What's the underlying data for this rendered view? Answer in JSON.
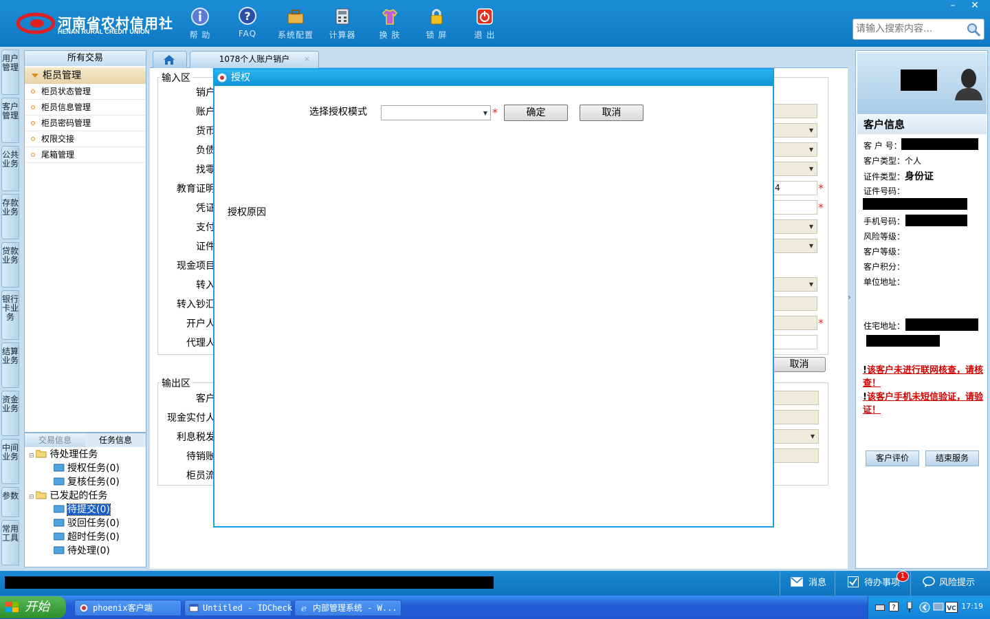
{
  "app": {
    "logo_cn": "河南省农村信用社",
    "logo_en": "HENAN RURAL CREDIT UNION"
  },
  "toolbar": [
    {
      "label": "帮 助",
      "icon": "info-icon"
    },
    {
      "label": "FAQ",
      "icon": "question-icon"
    },
    {
      "label": "系统配置",
      "icon": "toolbox-icon"
    },
    {
      "label": "计算器",
      "icon": "calculator-icon"
    },
    {
      "label": "换 肤",
      "icon": "shirt-icon"
    },
    {
      "label": "锁 屏",
      "icon": "lock-icon"
    },
    {
      "label": "退 出",
      "icon": "power-icon"
    }
  ],
  "window_controls": {
    "minimize": "–",
    "close": "✕"
  },
  "search": {
    "placeholder": "请输入搜索内容..."
  },
  "vtabs": [
    "用户管理",
    "客户管理",
    "公共业务",
    "存款业务",
    "贷款业务",
    "银行卡业务",
    "结算业务",
    "资金业务",
    "中间业务",
    "参数",
    "常用工具"
  ],
  "menu": {
    "header": "所有交易",
    "group": "柜员管理",
    "items": [
      "柜员状态管理",
      "柜员信息管理",
      "柜员密码管理",
      "权限交接",
      "尾箱管理"
    ]
  },
  "task_panel": {
    "tabs": [
      "交易信息",
      "任务信息"
    ],
    "tree": [
      {
        "label": "待处理任务",
        "level": 0
      },
      {
        "label": "授权任务(0)",
        "level": 1
      },
      {
        "label": "复核任务(0)",
        "level": 1
      },
      {
        "label": "已发起的任务",
        "level": 0
      },
      {
        "label": "待提交(0)",
        "level": 1
      },
      {
        "label": "驳回任务(0)",
        "level": 1
      },
      {
        "label": "超时任务(0)",
        "level": 1
      },
      {
        "label": "待处理(0)",
        "level": 1
      }
    ]
  },
  "tabs": {
    "active": "1078个人账户销户",
    "close": "×"
  },
  "input_area": {
    "legend": "输入区",
    "labels": [
      "销户",
      "账户",
      "货币",
      "负债",
      "找零",
      "教育证明",
      "凭证",
      "支付",
      "证件",
      "现金项目",
      "转入",
      "转入钞汇",
      "开户人",
      "代理人"
    ],
    "partial_value": "4"
  },
  "output_area": {
    "legend": "输出区",
    "labels": [
      "客户",
      "现金实付人",
      "利息税发",
      "待销账",
      "柜员流"
    ]
  },
  "bg_cancel": "取消",
  "dialog": {
    "title": "授权",
    "mode_label": "选择授权模式",
    "mode_value": "",
    "ok": "确定",
    "cancel": "取消",
    "reason_label": "授权原因",
    "required": "*"
  },
  "customer": {
    "section_title": "客户信息",
    "fields": [
      {
        "label": "客 户 号：",
        "value": ""
      },
      {
        "label": "客户类型：",
        "value": "个人"
      },
      {
        "label": "证件类型：",
        "value": "身份证"
      },
      {
        "label": "证件号码：",
        "value": ""
      },
      {
        "label": "手机号码：",
        "value": ""
      },
      {
        "label": "风险等级：",
        "value": ""
      },
      {
        "label": "客户等级：",
        "value": ""
      },
      {
        "label": "客户积分：",
        "value": ""
      },
      {
        "label": "单位地址：",
        "value": ""
      },
      {
        "label": "住宅地址：",
        "value": ""
      }
    ],
    "warnings": [
      "该客户未进行联网核查，请核查！",
      "该客户手机未短信验证，请验证！"
    ],
    "buttons": [
      "客户评价",
      "结束服务"
    ]
  },
  "statusbar": {
    "messages": "消息",
    "todo": "待办事项",
    "todo_badge": "1",
    "risk": "风险提示"
  },
  "taskbar": {
    "start": "开始",
    "windows": [
      "phoenix客户端",
      "Untitled - IDCheck",
      "内部管理系统 - W..."
    ],
    "time": "17:19"
  },
  "colors": {
    "header": "#1c8ed6",
    "dialog_title": "#0e94d8",
    "warning": "#d30000",
    "selection": "#1a5fc8"
  }
}
